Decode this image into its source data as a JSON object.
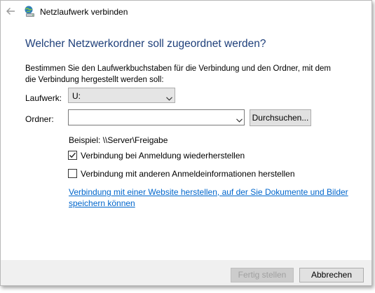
{
  "window": {
    "title": "Netzlaufwerk verbinden"
  },
  "icons": {
    "back": "back-arrow-icon",
    "app": "network-drive-icon",
    "dropdown": "chevron-down-icon",
    "check": "checkmark-icon"
  },
  "main": {
    "heading": "Welcher Netzwerkordner soll zugeordnet werden?",
    "description": "Bestimmen Sie den Laufwerkbuchstaben für die Verbindung und den Ordner, mit dem die Verbindung hergestellt werden soll:",
    "drive_label": "Laufwerk:",
    "drive_value": "U:",
    "folder_label": "Ordner:",
    "folder_value": "",
    "browse_label": "Durchsuchen...",
    "example": "Beispiel: \\\\Server\\Freigabe",
    "reconnect_label": "Verbindung bei Anmeldung wiederherstellen",
    "reconnect_checked": true,
    "credentials_label": "Verbindung mit anderen Anmeldeinformationen herstellen",
    "credentials_checked": false,
    "link_text": "Verbindung mit einer Website herstellen, auf der Sie Dokumente und Bilder speichern können"
  },
  "footer": {
    "finish_label": "Fertig stellen",
    "cancel_label": "Abbrechen"
  },
  "colors": {
    "heading": "#1e3f7a",
    "link": "#0066cc",
    "footer_bg": "#f0f0f0"
  }
}
